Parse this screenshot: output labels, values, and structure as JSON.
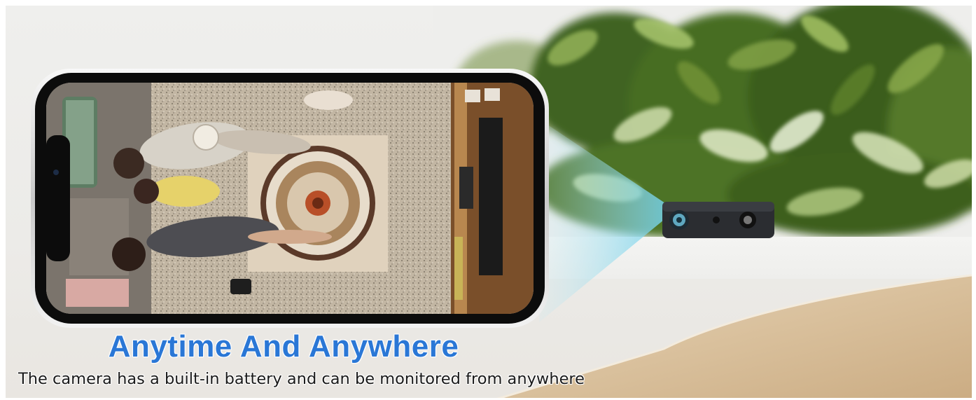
{
  "headline": "Anytime And Anywhere",
  "subheadline": "The camera has a built-in battery and can be monitored from anywhere",
  "colors": {
    "headline": "#2a77d6",
    "subheadline": "#1a1a1a",
    "beam": "#7fd3ea",
    "camera_body": "#2b2d31"
  },
  "icons": [
    "phone-icon",
    "camera-icon"
  ]
}
